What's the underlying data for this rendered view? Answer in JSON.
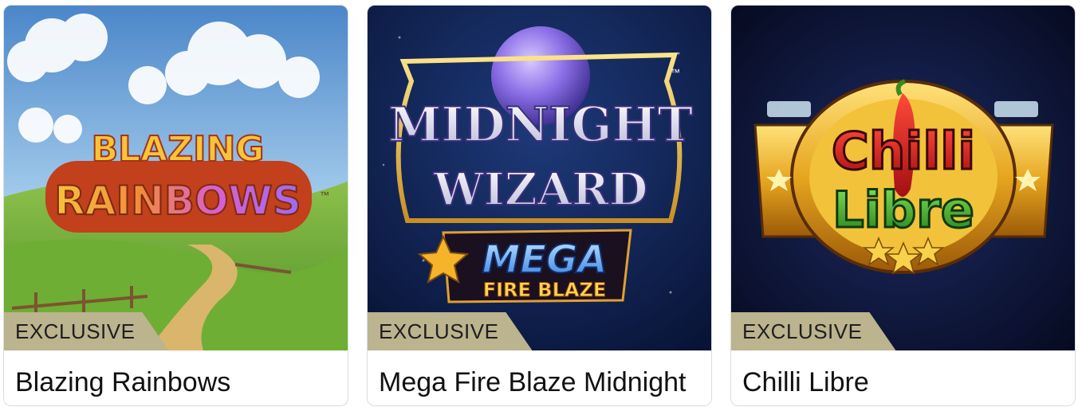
{
  "cards": [
    {
      "badge": "EXCLUSIVE",
      "title": "Blazing Rainbows",
      "art_logo": [
        "BLAZING",
        "RAINBOWS"
      ],
      "art_tm": "™"
    },
    {
      "badge": "EXCLUSIVE",
      "title": "Mega Fire Blaze Midnight",
      "art_logo": [
        "MIDNIGHT",
        "WIZARD",
        "MEGA",
        "FIRE BLAZE"
      ],
      "art_tm": "™"
    },
    {
      "badge": "EXCLUSIVE",
      "title": "Chilli Libre",
      "art_logo": [
        "Chilli",
        "Libre"
      ]
    }
  ],
  "colors": {
    "badge": "#bcb38f",
    "card_border": "#d9dcdf",
    "title_text": "#111111"
  }
}
